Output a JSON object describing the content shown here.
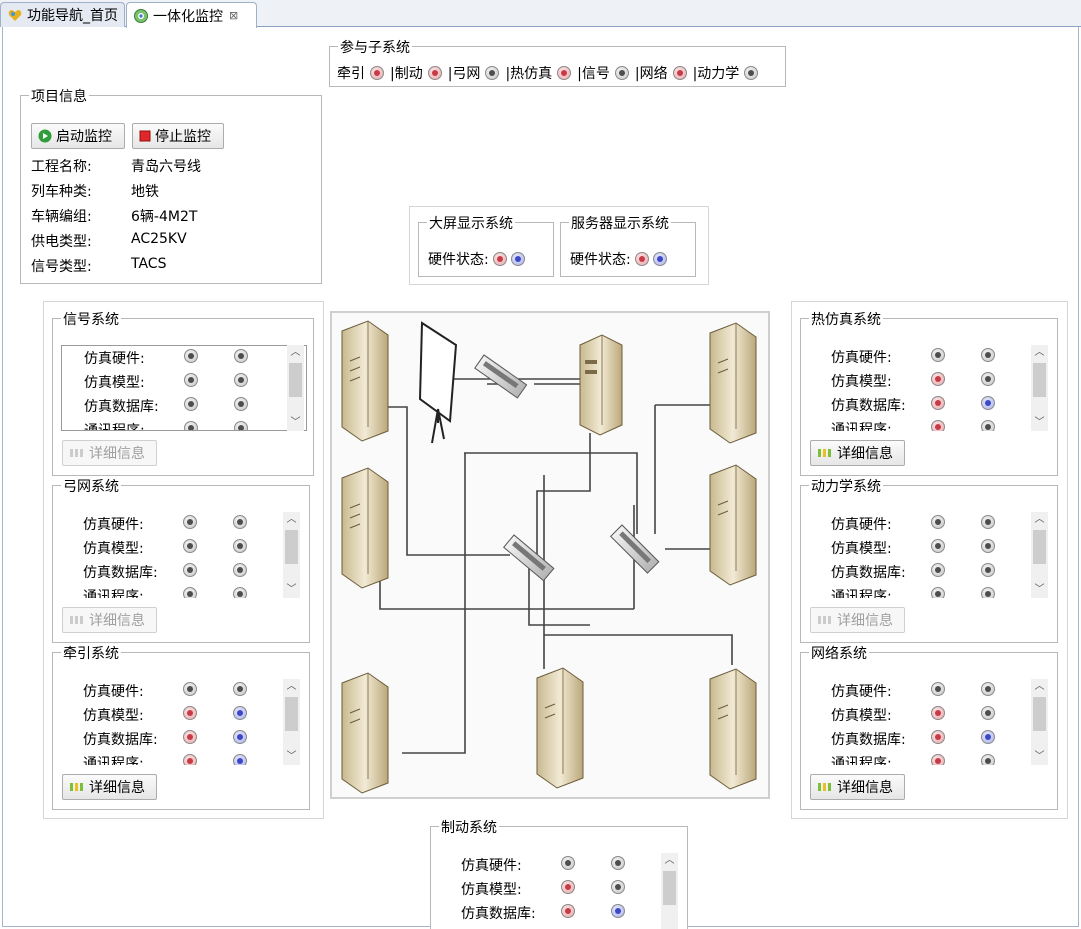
{
  "tabs": [
    {
      "label": "功能导航_首页",
      "icon": "home-heart-icon"
    },
    {
      "label": "一体化监控",
      "icon": "monitor-globe-icon",
      "close": "⊠"
    }
  ],
  "participants": {
    "title": "参与子系统",
    "items": [
      {
        "label": "牵引",
        "status": "red"
      },
      {
        "label": "|制动",
        "status": "red"
      },
      {
        "label": "|弓网",
        "status": "gray"
      },
      {
        "label": "|热仿真",
        "status": "red"
      },
      {
        "label": "|信号",
        "status": "gray"
      },
      {
        "label": "|网络",
        "status": "red"
      },
      {
        "label": "|动力学",
        "status": "gray"
      }
    ]
  },
  "project": {
    "title": "项目信息",
    "start_label": "启动监控",
    "stop_label": "停止监控",
    "fields": [
      {
        "label": "工程名称:",
        "value": "青岛六号线"
      },
      {
        "label": "列车种类:",
        "value": "地铁"
      },
      {
        "label": "车辆编组:",
        "value": "6辆-4M2T"
      },
      {
        "label": "供电类型:",
        "value": "AC25KV"
      },
      {
        "label": "信号类型:",
        "value": "TACS"
      }
    ]
  },
  "displays": [
    {
      "title": "大屏显示系统",
      "status_label": "硬件状态:",
      "leds": [
        "red",
        "blue"
      ]
    },
    {
      "title": "服务器显示系统",
      "status_label": "硬件状态:",
      "leds": [
        "red",
        "blue"
      ]
    }
  ],
  "row_labels": [
    "仿真硬件:",
    "仿真模型:",
    "仿真数据库:",
    "通讯程序:"
  ],
  "detail_label": "详细信息",
  "subsystems": {
    "signal": {
      "title": "信号系统",
      "leds": [
        [
          "gray",
          "gray"
        ],
        [
          "gray",
          "gray"
        ],
        [
          "gray",
          "gray"
        ],
        [
          "gray",
          "gray"
        ]
      ],
      "detail_enabled": false
    },
    "pantograph": {
      "title": "弓网系统",
      "leds": [
        [
          "gray",
          "gray"
        ],
        [
          "gray",
          "gray"
        ],
        [
          "gray",
          "gray"
        ],
        [
          "gray",
          "gray"
        ]
      ],
      "detail_enabled": false
    },
    "traction": {
      "title": "牵引系统",
      "leds": [
        [
          "gray",
          "gray"
        ],
        [
          "red",
          "blue"
        ],
        [
          "red",
          "blue"
        ],
        [
          "red",
          "blue"
        ]
      ],
      "detail_enabled": true
    },
    "thermal": {
      "title": "热仿真系统",
      "leds": [
        [
          "gray",
          "gray"
        ],
        [
          "red",
          "gray"
        ],
        [
          "red",
          "blue"
        ],
        [
          "red",
          "gray"
        ]
      ],
      "detail_enabled": true
    },
    "dynamics": {
      "title": "动力学系统",
      "leds": [
        [
          "gray",
          "gray"
        ],
        [
          "gray",
          "gray"
        ],
        [
          "gray",
          "gray"
        ],
        [
          "gray",
          "gray"
        ]
      ],
      "detail_enabled": false
    },
    "network": {
      "title": "网络系统",
      "leds": [
        [
          "gray",
          "gray"
        ],
        [
          "red",
          "gray"
        ],
        [
          "red",
          "blue"
        ],
        [
          "red",
          "gray"
        ]
      ],
      "detail_enabled": true
    },
    "braking": {
      "title": "制动系统",
      "leds": [
        [
          "gray",
          "gray"
        ],
        [
          "red",
          "gray"
        ],
        [
          "red",
          "blue"
        ]
      ],
      "detail_enabled": false
    }
  },
  "colors": {
    "led_red": "#c83a48",
    "led_blue": "#3c48c8",
    "led_gray": "#4d4d4d",
    "tab_border": "#8da2c2"
  }
}
